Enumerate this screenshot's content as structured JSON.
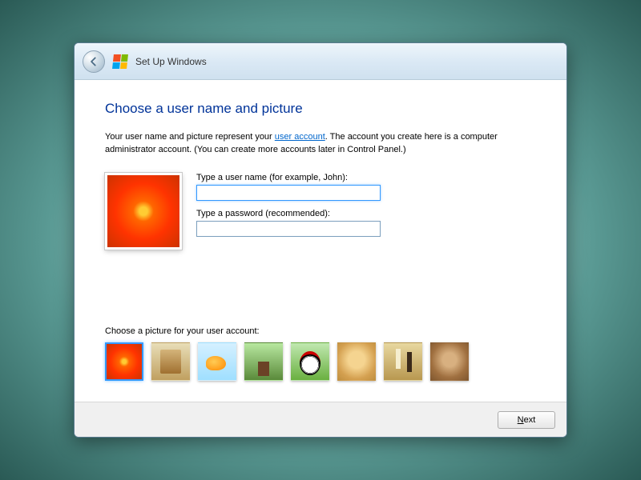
{
  "header": {
    "title": "Set Up Windows"
  },
  "page": {
    "heading": "Choose a user name and picture",
    "desc_pre": "Your user name and picture represent your ",
    "desc_link": "user account",
    "desc_post": ". The account you create here is a computer administrator account. (You can create more accounts later in Control Panel.)"
  },
  "form": {
    "username_label": "Type a user name (for example, John):",
    "username_value": "",
    "password_label": "Type a password (recommended):",
    "password_value": ""
  },
  "picture": {
    "label": "Choose a picture for your user account:",
    "selected": "flower",
    "options": [
      "flower",
      "robot",
      "fish",
      "bonsai",
      "soccer",
      "puppy",
      "chess",
      "kitten"
    ]
  },
  "footer": {
    "next_label": "Next"
  }
}
